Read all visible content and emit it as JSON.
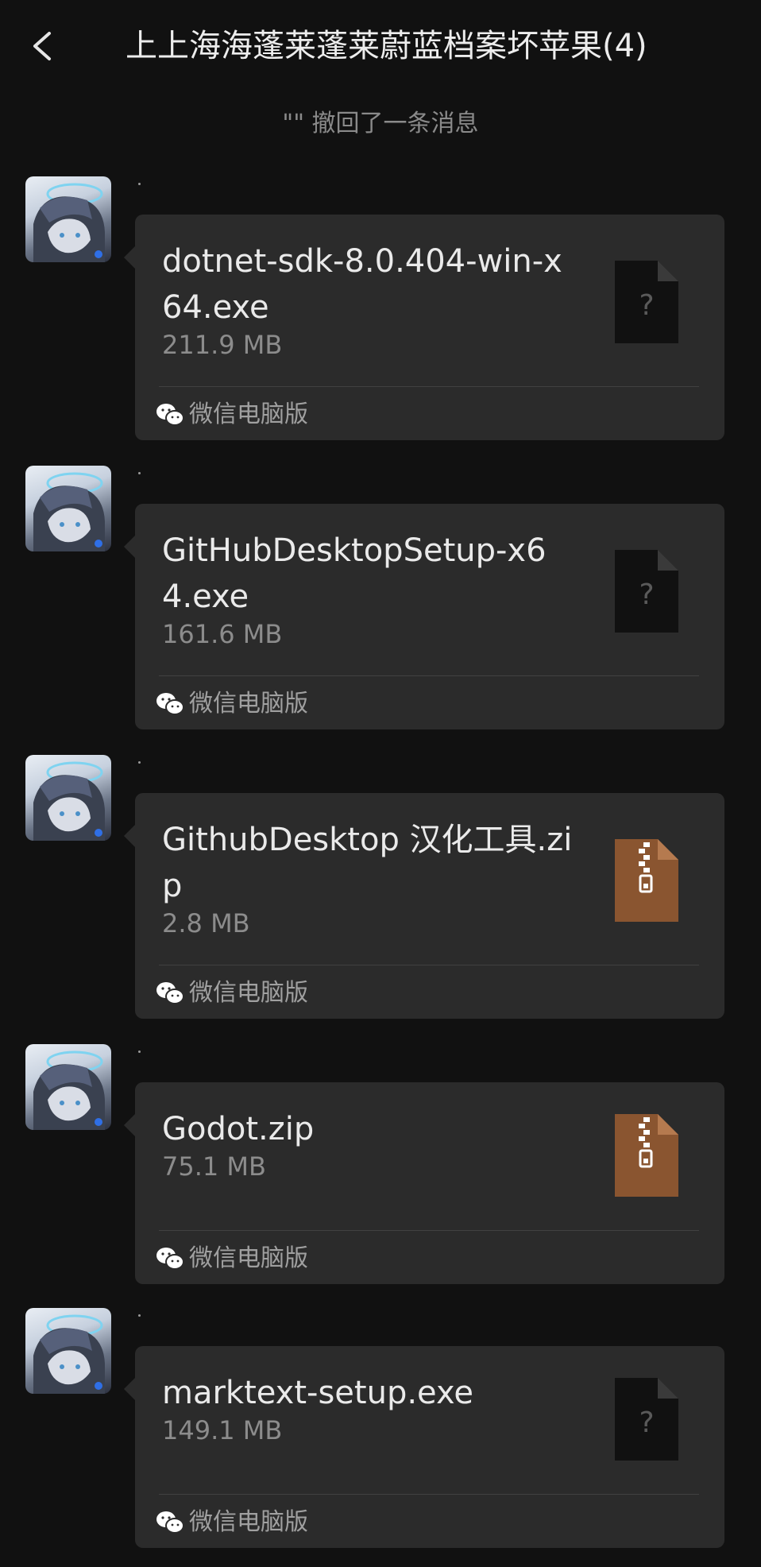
{
  "header": {
    "title": "上上海海蓬莱蓬莱蔚蓝档案坏苹果(4)"
  },
  "system_note": "\"\" 撤回了一条消息",
  "sender_name": ".",
  "messages": [
    {
      "file_name": "dotnet-sdk-8.0.404-win-x64.exe",
      "file_size": "211.9 MB",
      "file_type": "unknown-file-icon",
      "source": "微信电脑版"
    },
    {
      "file_name": "GitHubDesktopSetup-x64.exe",
      "file_size": "161.6 MB",
      "file_type": "unknown-file-icon",
      "source": "微信电脑版"
    },
    {
      "file_name": "GithubDesktop 汉化工具.zip",
      "file_size": "2.8 MB",
      "file_type": "zip-file-icon",
      "source": "微信电脑版"
    },
    {
      "file_name": "Godot.zip",
      "file_size": "75.1 MB",
      "file_type": "zip-file-icon",
      "source": "微信电脑版"
    },
    {
      "file_name": "marktext-setup.exe",
      "file_size": "149.1 MB",
      "file_type": "unknown-file-icon",
      "source": "微信电脑版"
    }
  ],
  "colors": {
    "background": "#111111",
    "bubble": "#2b2b2b",
    "zip_icon": "#8a5530",
    "unknown_icon": "#111111",
    "wechat_green": "#ffffff"
  }
}
